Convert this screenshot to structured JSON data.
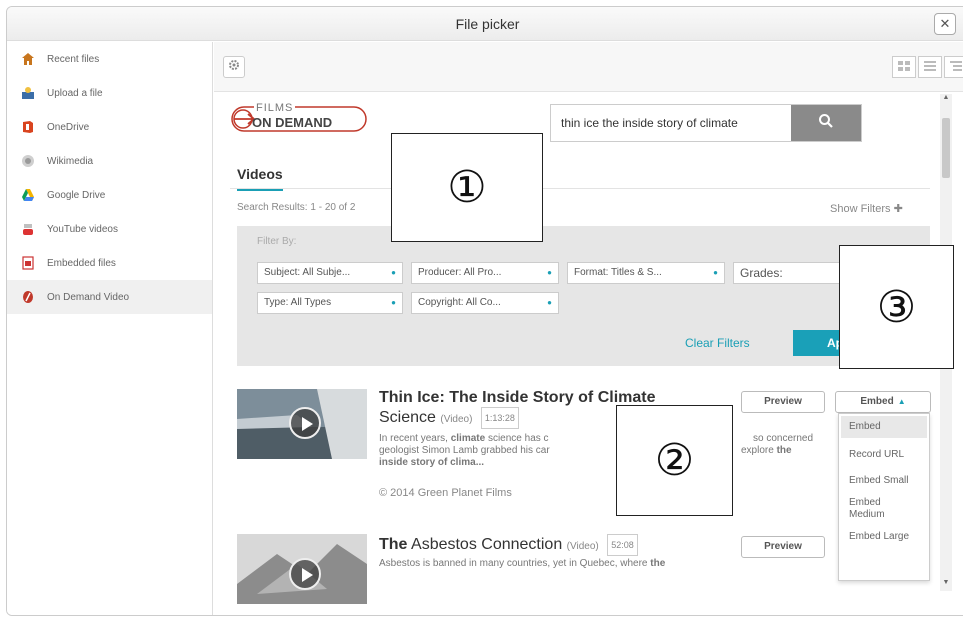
{
  "dialog": {
    "title": "File picker",
    "close": "✕"
  },
  "sidebar": {
    "items": [
      {
        "label": "Recent files",
        "icon": "recent-files-icon"
      },
      {
        "label": "Upload a file",
        "icon": "upload-icon"
      },
      {
        "label": "OneDrive",
        "icon": "onedrive-icon"
      },
      {
        "label": "Wikimedia",
        "icon": "wikimedia-icon"
      },
      {
        "label": "Google Drive",
        "icon": "google-drive-icon"
      },
      {
        "label": "YouTube videos",
        "icon": "youtube-icon"
      },
      {
        "label": "Embedded files",
        "icon": "embedded-files-icon"
      },
      {
        "label": "On Demand Video",
        "icon": "on-demand-video-icon"
      }
    ]
  },
  "logo": {
    "line1": "FILMS",
    "line2": "ON DEMAND"
  },
  "search": {
    "value": "thin ice the inside story of climate"
  },
  "tab": {
    "label": "Videos"
  },
  "results_count": "Search Results: 1 - 20 of 2",
  "show_filters": "Show Filters ✚",
  "filters": {
    "filter_by": "Filter By:",
    "subject": "Subject: All Subje...",
    "producer": "Producer: All Pro...",
    "format": "Format: Titles & S...",
    "grades": "Grades:",
    "type": "Type: All Types",
    "copyright": "Copyright: All Co...",
    "clear": "Clear Filters",
    "apply": "Ap"
  },
  "results": [
    {
      "title_bold": "Thin Ice",
      "title_rest": ": The Inside Story of Climate",
      "title_line2": "Science",
      "type": "(Video)",
      "duration": "1:13:28",
      "desc_a": "In recent years, ",
      "desc_b": "climate",
      "desc_c": " science has c",
      "desc_d": "so concerned",
      "desc_line2": "geologist Simon Lamb grabbed his car",
      "desc_line2b": "explore ",
      "desc_line2c": "the",
      "desc_line3": "inside story of clima...",
      "copyright": "© 2014 Green Planet Films",
      "preview": "Preview",
      "embed": "Embed"
    },
    {
      "title_bold": "The",
      "title_rest": " Asbestos Connection",
      "type": "(Video)",
      "duration": "52:08",
      "desc_a": "Asbestos is banned in many countries, yet in Quebec, where ",
      "desc_b": "the",
      "preview": "Preview"
    }
  ],
  "embed_menu": [
    "Embed",
    "Record URL",
    "Embed Small",
    "Embed Medium",
    "Embed Large"
  ],
  "annotations": [
    "①",
    "②",
    "③"
  ],
  "colors": {
    "accent": "#1aa0b8",
    "search_button": "#8a8a8a",
    "filter_bg": "#e6e6e6"
  }
}
